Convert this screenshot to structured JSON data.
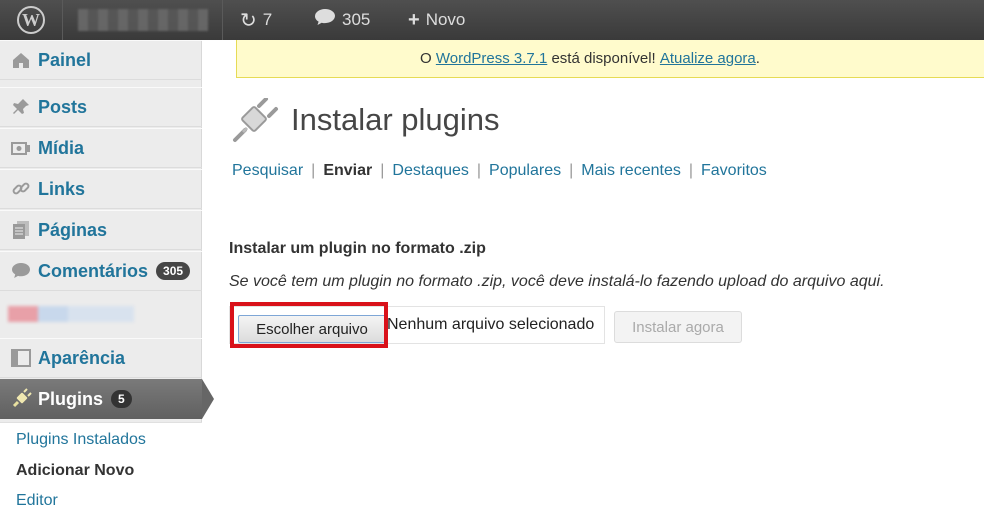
{
  "adminbar": {
    "wp_logo_icon": "wordpress-logo-icon",
    "updates": {
      "icon": "refresh-icon",
      "count": "7"
    },
    "comments": {
      "icon": "comment-bubble-icon",
      "count": "305"
    },
    "new": {
      "icon": "plus-icon",
      "label": "Novo"
    }
  },
  "sidebar": {
    "items": [
      {
        "label": "Painel",
        "icon": "dashboard-icon"
      },
      {
        "label": "Posts",
        "icon": "pushpin-icon"
      },
      {
        "label": "Mídia",
        "icon": "media-icon"
      },
      {
        "label": "Links",
        "icon": "link-icon"
      },
      {
        "label": "Páginas",
        "icon": "pages-icon"
      },
      {
        "label": "Comentários",
        "icon": "comments-icon",
        "badge": "305"
      },
      {
        "label": "Aparência",
        "icon": "appearance-icon"
      },
      {
        "label": "Plugins",
        "icon": "plugin-icon",
        "badge": "5"
      }
    ],
    "submenu": [
      {
        "label": "Plugins Instalados"
      },
      {
        "label": "Adicionar Novo"
      },
      {
        "label": "Editor"
      }
    ]
  },
  "notice": {
    "prefix": "O",
    "version_link": "WordPress 3.7.1",
    "middle": "está disponível!",
    "update_link": "Atualize agora",
    "suffix": "."
  },
  "page": {
    "title": "Instalar plugins",
    "tabs": [
      {
        "label": "Pesquisar"
      },
      {
        "label": "Enviar"
      },
      {
        "label": "Destaques"
      },
      {
        "label": "Populares"
      },
      {
        "label": "Mais recentes"
      },
      {
        "label": "Favoritos"
      }
    ],
    "section_title": "Instalar um plugin no formato .zip",
    "help_text": "Se você tem um plugin no formato .zip, você deve instalá-lo fazendo upload do arquivo aqui.",
    "choose_file_label": "Escolher arquivo",
    "file_status": "Nenhum arquivo selecionado",
    "install_label": "Instalar agora"
  },
  "colors": {
    "link": "#21759b",
    "highlight": "#d9111a",
    "notice_bg": "#fffbcc"
  }
}
